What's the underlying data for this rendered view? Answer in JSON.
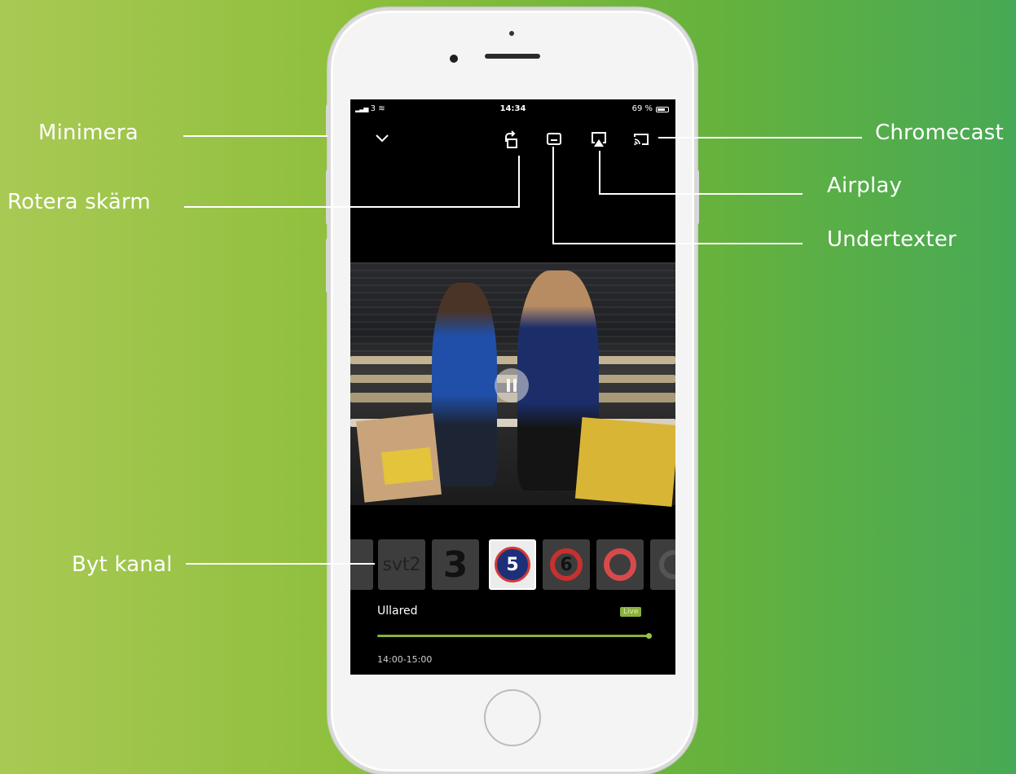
{
  "callouts": {
    "minimera": "Minimera",
    "rotera": "Rotera skärm",
    "chromecast": "Chromecast",
    "airplay": "Airplay",
    "undertexter": "Undertexter",
    "byt_kanal": "Byt kanal"
  },
  "status_bar": {
    "signal": "3",
    "time": "14:34",
    "battery": "69 %"
  },
  "channels": [
    "",
    "svt2",
    "3",
    "5",
    "6",
    "",
    ""
  ],
  "selected_channel": "5",
  "program": {
    "title": "Ullared",
    "badge": "Live",
    "time_range": "14:00-15:00",
    "progress": 1.0
  },
  "colors": {
    "accent": "#8ab03a",
    "background_left": "#a9c954",
    "background_right": "#47a955"
  },
  "icons": {
    "minimize": "chevron-down-icon",
    "rotate": "rotate-screen-icon",
    "subtitles": "subtitles-icon",
    "airplay": "airplay-icon",
    "chromecast": "chromecast-icon",
    "play_state": "pause-icon"
  }
}
